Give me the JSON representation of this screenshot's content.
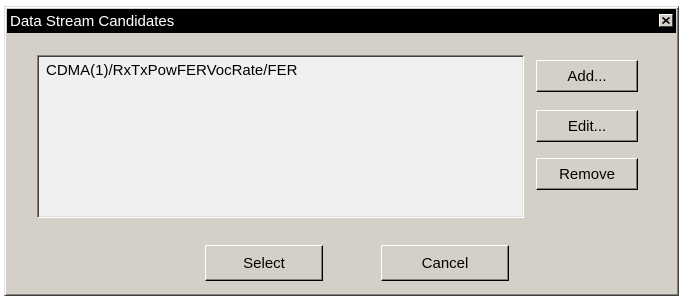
{
  "window": {
    "title": "Data Stream Candidates"
  },
  "titlebar": {
    "close_icon": "close-icon"
  },
  "list": {
    "items": [
      "CDMA(1)/RxTxPowFERVocRate/FER"
    ]
  },
  "buttons": {
    "add": "Add...",
    "edit": "Edit...",
    "remove": "Remove",
    "select": "Select",
    "cancel": "Cancel"
  },
  "colors": {
    "dialog_face": "#d4d0c8",
    "titlebar_bg": "#000000",
    "titlebar_text": "#ffffff",
    "list_bg": "#f0f0f0"
  }
}
